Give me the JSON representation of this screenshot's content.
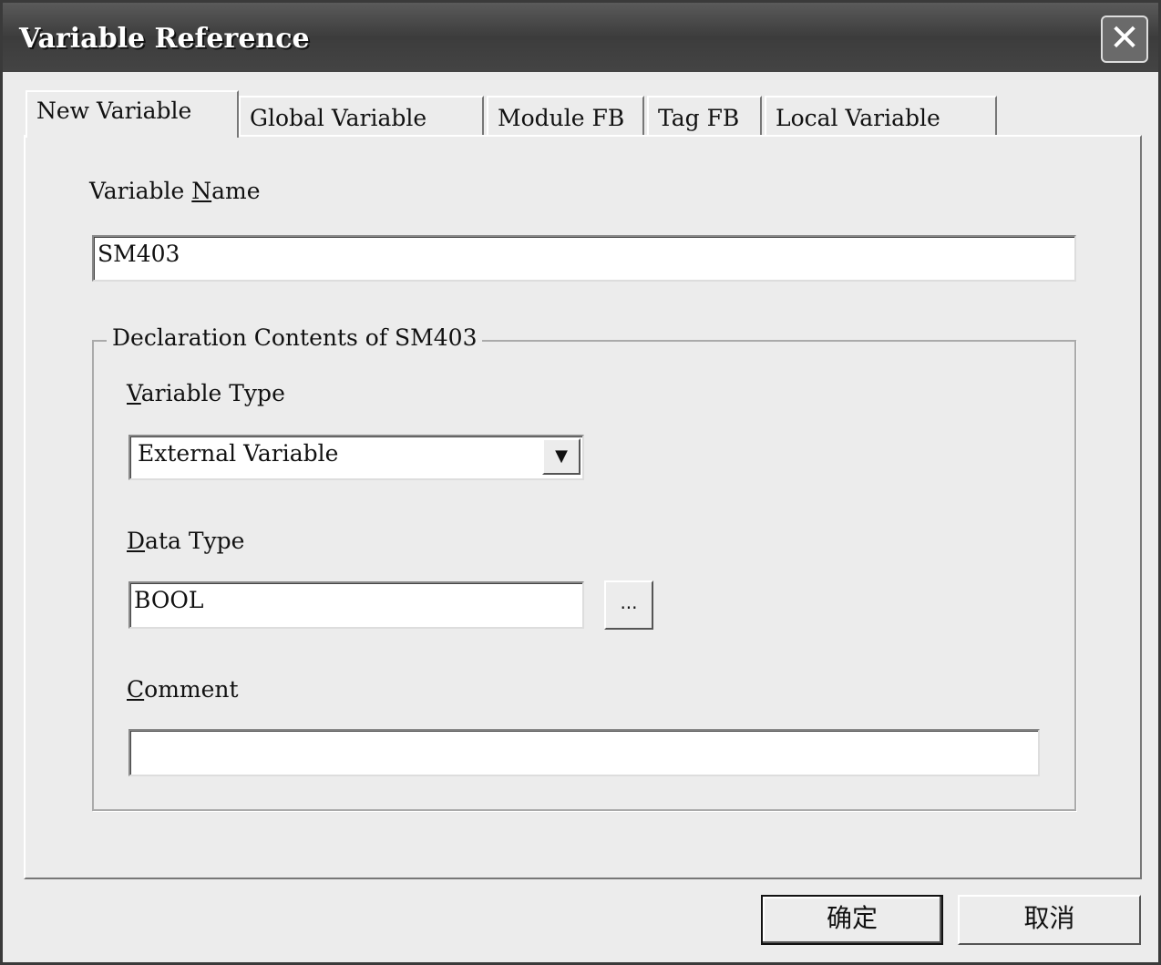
{
  "window": {
    "title": "Variable Reference",
    "close_icon": "close-icon"
  },
  "tabs": [
    {
      "label": "New Variable",
      "active": true
    },
    {
      "label": "Global Variable"
    },
    {
      "label": "Module FB"
    },
    {
      "label": "Tag FB"
    },
    {
      "label": "Local Variable"
    }
  ],
  "variable_name": {
    "label_pre": "Variable ",
    "label_key": "N",
    "label_post": "ame",
    "value": "SM403"
  },
  "group": {
    "title": "Declaration Contents of SM403"
  },
  "variable_type": {
    "label_key": "V",
    "label_post": "ariable Type",
    "value": "External Variable"
  },
  "data_type": {
    "label_key": "D",
    "label_post": "ata Type",
    "value": "BOOL",
    "browse_label": "..."
  },
  "comment": {
    "label_key": "C",
    "label_post": "omment",
    "value": ""
  },
  "buttons": {
    "ok": "确定",
    "cancel": "取消"
  }
}
